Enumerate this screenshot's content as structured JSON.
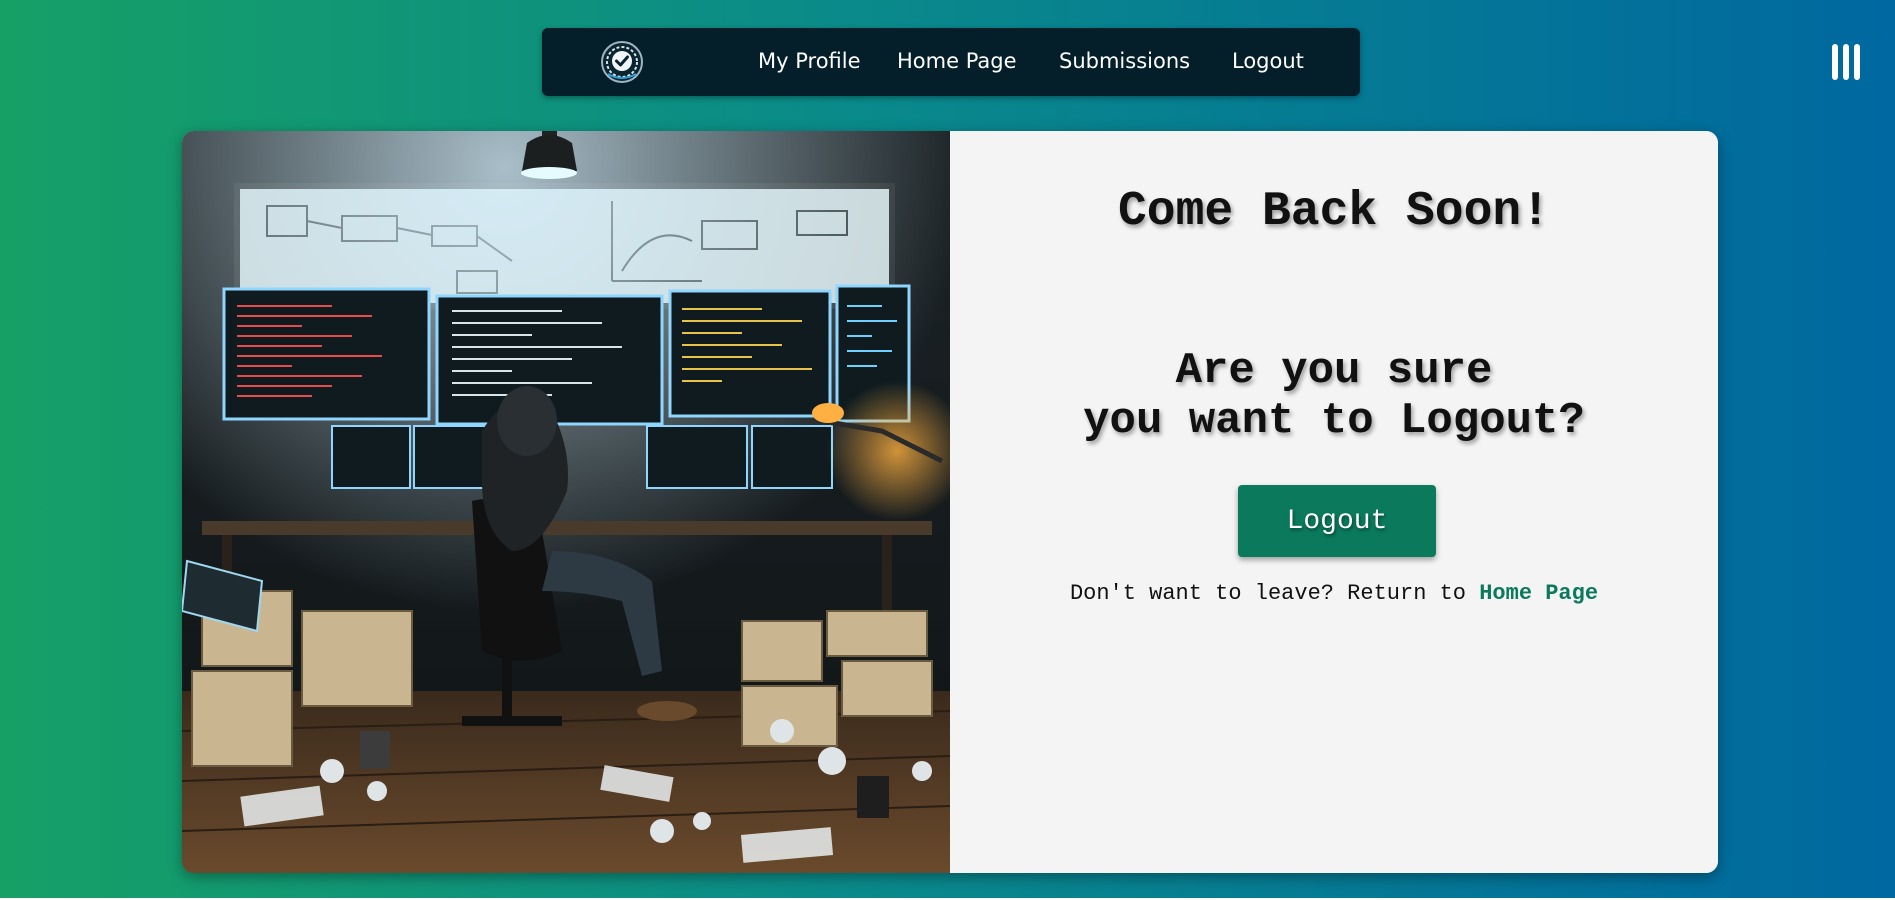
{
  "nav": {
    "logo_icon": "check-shield-logo-icon",
    "links": [
      {
        "label": "My Profile"
      },
      {
        "label": "Home Page"
      },
      {
        "label": "Submissions"
      },
      {
        "label": "Logout"
      }
    ],
    "menu_icon": "hamburger-menu-icon"
  },
  "illustration": {
    "icon": "developer-workspace-illustration"
  },
  "logout_panel": {
    "title": "Come Back Soon!",
    "question_line1": "Are you sure",
    "question_line2": "you want to Logout?",
    "logout_button_label": "Logout",
    "stay_text": "Don't want to leave? Return to",
    "home_link_label": "Home Page"
  },
  "colors": {
    "gradient_start": "#16a066",
    "gradient_end": "#0068a0",
    "navbar_bg": "#041f2a",
    "accent": "#0b7a5c",
    "panel_bg": "#f4f4f4"
  }
}
